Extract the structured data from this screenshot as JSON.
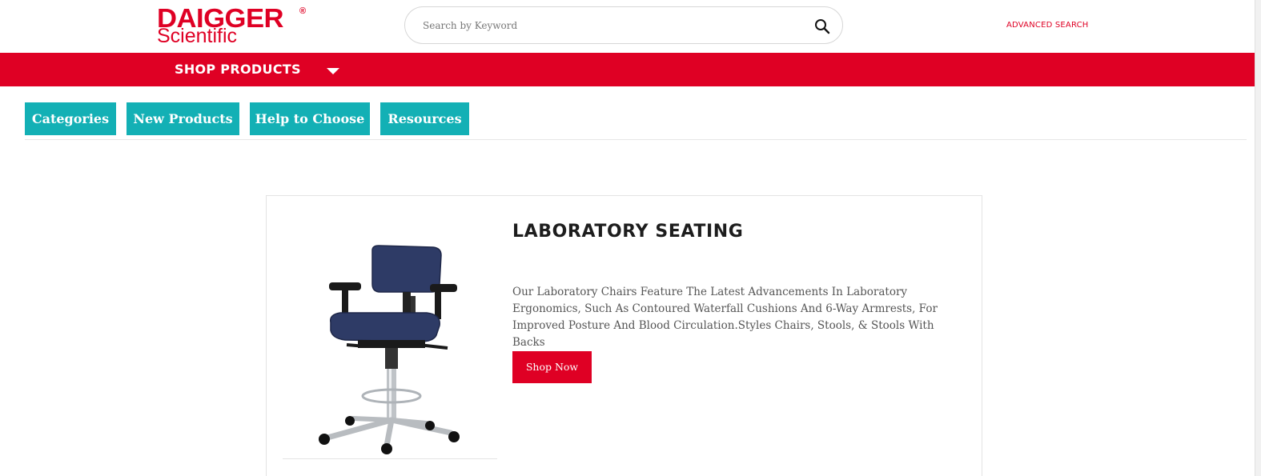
{
  "header": {
    "logo_brand": "DAIGGER",
    "logo_reg": "®",
    "logo_sub": "Scientific",
    "search_placeholder": "Search by Keyword",
    "advanced_search": "ADVANCED SEARCH"
  },
  "nav": {
    "shop_products": "SHOP PRODUCTS"
  },
  "tabs": [
    {
      "label": "Categories"
    },
    {
      "label": "New Products"
    },
    {
      "label": "Help to Choose"
    },
    {
      "label": "Resources"
    }
  ],
  "feature": {
    "title": "LABORATORY SEATING",
    "description": "Our Laboratory Chairs Feature The Latest Advancements In Laboratory Ergonomics, Such As Contoured Waterfall Cushions And 6-Way Armrests, For Improved Posture And Blood Circulation.Styles Chairs, Stools, & Stools With Backs",
    "button": "Shop Now"
  },
  "colors": {
    "brand_red": "#df0024",
    "tab_teal": "#13b0b5"
  },
  "icons": {
    "search": "search-icon",
    "caret": "caret-down-icon"
  }
}
